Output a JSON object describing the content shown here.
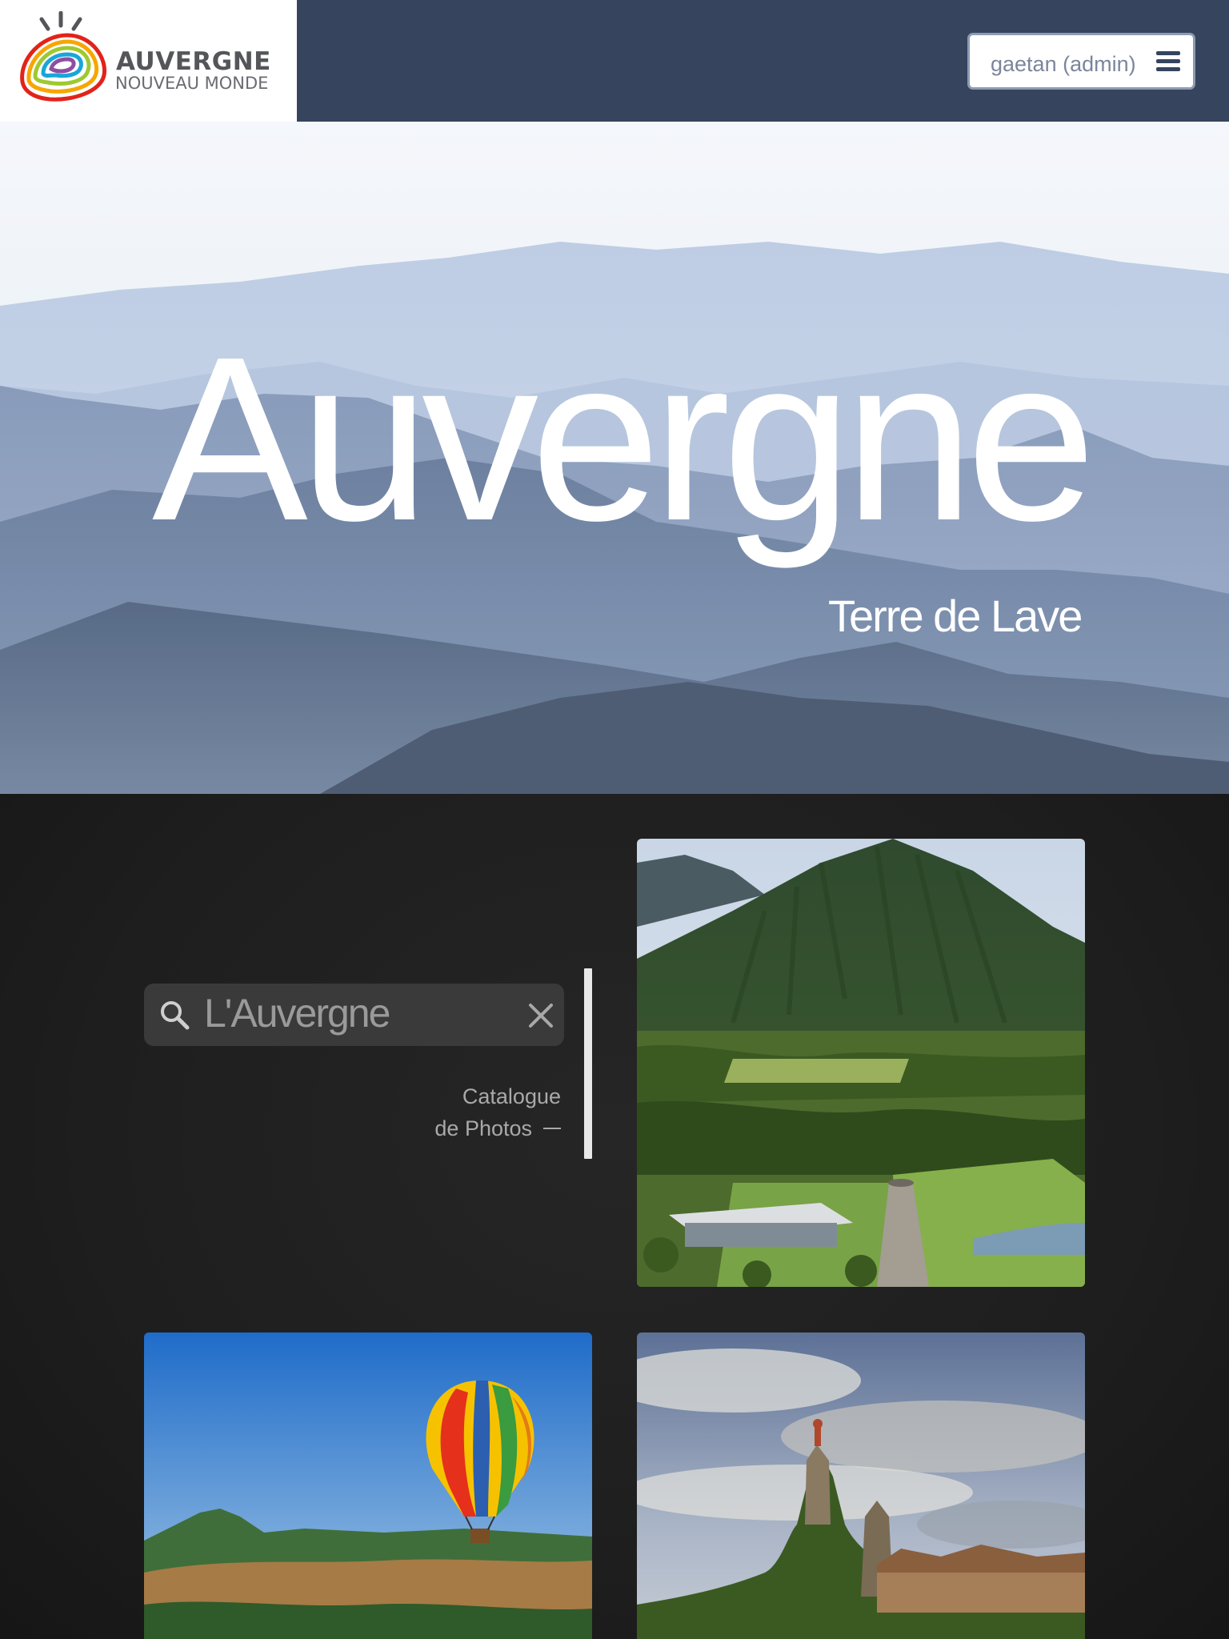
{
  "header": {
    "logo": {
      "title": "AUVERGNE",
      "subtitle": "NOUVEAU MONDE",
      "icon": "rainbow-volcano-logo"
    },
    "user_menu": {
      "label": "gaetan (admin)",
      "icon": "hamburger-menu-icon"
    },
    "colors": {
      "bar": "#36445d",
      "logo_bg": "#ffffff"
    }
  },
  "hero": {
    "title": "Auvergne",
    "subtitle": "Terre de Lave"
  },
  "search": {
    "placeholder": "L'Auvergne",
    "value": "",
    "icons": {
      "search": "search-icon",
      "clear": "close-icon"
    }
  },
  "catalogue": {
    "line1": "Catalogue",
    "line2": "de Photos"
  },
  "photos": [
    {
      "subject": "volcano-park-aerial"
    },
    {
      "subject": "hot-air-balloon-over-puy-de-dome"
    },
    {
      "subject": "le-puy-en-velay-rock-chapel"
    }
  ]
}
